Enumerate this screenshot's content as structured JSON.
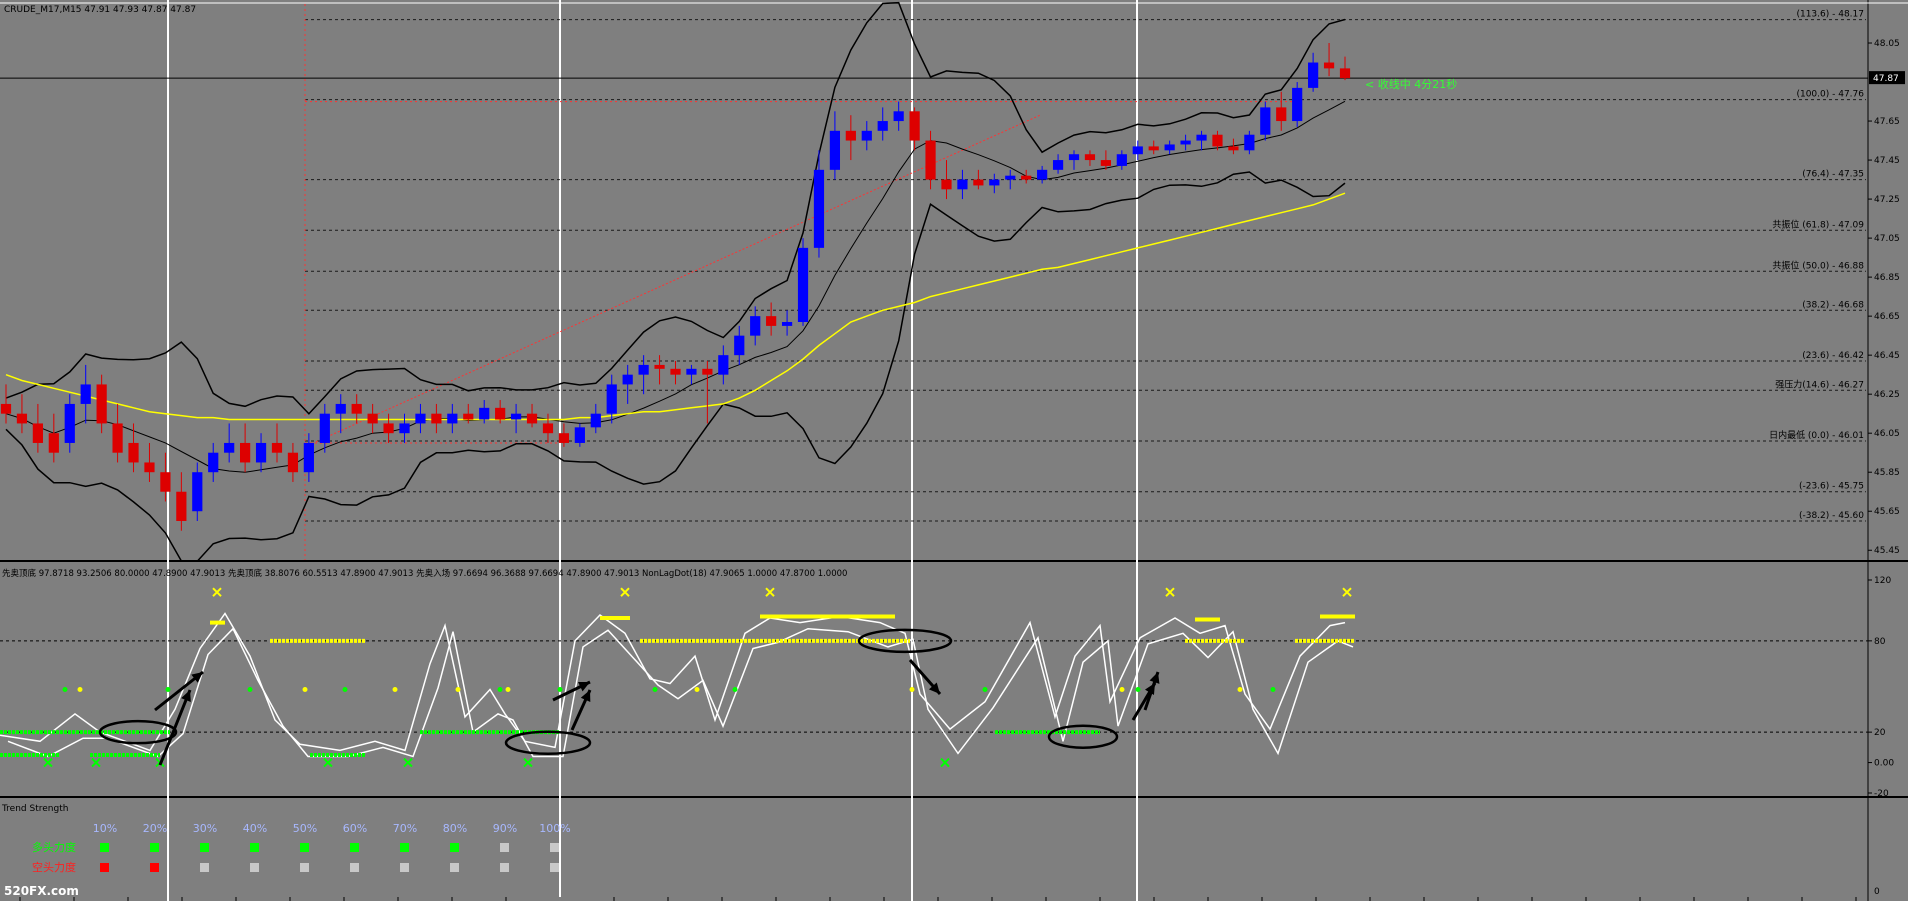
{
  "header": {
    "symbol": "CRUDE_M17,M15",
    "ohlc": "47.91 47.93 47.87 47.87"
  },
  "countdown": "< 收线中 4分21秒",
  "price_tag": "47.87",
  "colors": {
    "bg": "#7f7f7f",
    "bull": "#0000ff",
    "bear": "#dd0000",
    "bands": "#000000",
    "ma": "#ffff00",
    "green": "#00ff00",
    "yellow": "#ffff00",
    "white": "#ffffff"
  },
  "fib_labels": [
    {
      "label": "(113.6) - 48.17",
      "price": 48.17
    },
    {
      "label": "(100.0) - 47.76",
      "price": 47.76
    },
    {
      "label": "(76.4) - 47.35",
      "price": 47.35
    },
    {
      "label": "共振位 (61.8) - 47.09",
      "price": 47.09
    },
    {
      "label": "共振位 (50.0) - 46.88",
      "price": 46.88
    },
    {
      "label": "(38.2) - 46.68",
      "price": 46.68
    },
    {
      "label": "(23.6) - 46.42",
      "price": 46.42
    },
    {
      "label": "强压力(14.6) - 46.27",
      "price": 46.27
    },
    {
      "label": "日内最低 (0.0) - 46.01",
      "price": 46.01
    },
    {
      "label": "(-23.6) - 45.75",
      "price": 45.75
    },
    {
      "label": "(-38.2) - 45.60",
      "price": 45.6
    }
  ],
  "price_axis_ticks": [
    "48.05",
    "47.65",
    "47.45",
    "47.25",
    "47.05",
    "46.85",
    "46.65",
    "46.45",
    "46.25",
    "46.05",
    "45.85",
    "45.65",
    "45.45"
  ],
  "osc_header": "先奥顶底 97.8718 93.2506 80.0000 47.8900 47.9013   先奥顶底 38.8076 60.5513 47.8900 47.9013   先奥入场 97.6694 96.3688 97.6694 47.8900 47.9013   NonLagDot(18) 47.9065 1.0000 47.8700 1.0000",
  "osc_axis_ticks": [
    "120",
    "80",
    "20",
    "0.00",
    "-20"
  ],
  "trend": {
    "title": "Trend Strength",
    "percent_labels": [
      "10%",
      "20%",
      "30%",
      "40%",
      "50%",
      "60%",
      "70%",
      "80%",
      "90%",
      "100%"
    ],
    "bull_label": "多头力度",
    "bear_label": "空头力度",
    "bull_cells": [
      "#00ff00",
      "#00ff00",
      "#00ff00",
      "#00ff00",
      "#00ff00",
      "#00ff00",
      "#00ff00",
      "#00ff00",
      "#c8c8c8",
      "#c8c8c8"
    ],
    "bear_cells": [
      "#ff0000",
      "#ff0000",
      "#c8c8c8",
      "#c8c8c8",
      "#c8c8c8",
      "#c8c8c8",
      "#c8c8c8",
      "#c8c8c8",
      "#c8c8c8",
      "#c8c8c8"
    ],
    "axis_ticks": [
      "0"
    ]
  },
  "watermark": "520FX.com",
  "chart_data": {
    "type": "candlestick",
    "y_range": [
      45.4,
      48.25
    ],
    "ohlc": [
      [
        46.2,
        46.3,
        46.1,
        46.15
      ],
      [
        46.15,
        46.25,
        46.05,
        46.1
      ],
      [
        46.1,
        46.2,
        45.95,
        46.0
      ],
      [
        46.05,
        46.15,
        45.9,
        45.95
      ],
      [
        46.0,
        46.25,
        45.95,
        46.2
      ],
      [
        46.2,
        46.4,
        46.1,
        46.3
      ],
      [
        46.3,
        46.35,
        46.05,
        46.1
      ],
      [
        46.1,
        46.2,
        45.9,
        45.95
      ],
      [
        46.0,
        46.1,
        45.85,
        45.9
      ],
      [
        45.9,
        46.0,
        45.8,
        45.85
      ],
      [
        45.85,
        45.95,
        45.7,
        45.75
      ],
      [
        45.75,
        45.85,
        45.55,
        45.6
      ],
      [
        45.65,
        45.9,
        45.6,
        45.85
      ],
      [
        45.85,
        46.0,
        45.8,
        45.95
      ],
      [
        45.95,
        46.1,
        45.9,
        46.0
      ],
      [
        46.0,
        46.1,
        45.85,
        45.9
      ],
      [
        45.9,
        46.05,
        45.85,
        46.0
      ],
      [
        46.0,
        46.1,
        45.9,
        45.95
      ],
      [
        45.95,
        46.0,
        45.8,
        45.85
      ],
      [
        45.85,
        46.05,
        45.8,
        46.0
      ],
      [
        46.0,
        46.2,
        45.95,
        46.15
      ],
      [
        46.15,
        46.25,
        46.05,
        46.2
      ],
      [
        46.2,
        46.25,
        46.1,
        46.15
      ],
      [
        46.15,
        46.2,
        46.05,
        46.1
      ],
      [
        46.1,
        46.15,
        46.0,
        46.05
      ],
      [
        46.05,
        46.15,
        46.0,
        46.1
      ],
      [
        46.1,
        46.2,
        46.05,
        46.15
      ],
      [
        46.15,
        46.2,
        46.05,
        46.1
      ],
      [
        46.1,
        46.2,
        46.05,
        46.15
      ],
      [
        46.15,
        46.2,
        46.1,
        46.12
      ],
      [
        46.12,
        46.22,
        46.1,
        46.18
      ],
      [
        46.18,
        46.22,
        46.1,
        46.12
      ],
      [
        46.12,
        46.2,
        46.05,
        46.15
      ],
      [
        46.15,
        46.2,
        46.08,
        46.1
      ],
      [
        46.1,
        46.15,
        46.0,
        46.05
      ],
      [
        46.05,
        46.1,
        45.98,
        46.0
      ],
      [
        46.0,
        46.1,
        45.98,
        46.08
      ],
      [
        46.08,
        46.2,
        46.05,
        46.15
      ],
      [
        46.15,
        46.35,
        46.1,
        46.3
      ],
      [
        46.3,
        46.4,
        46.2,
        46.35
      ],
      [
        46.35,
        46.45,
        46.25,
        46.4
      ],
      [
        46.4,
        46.45,
        46.3,
        46.38
      ],
      [
        46.38,
        46.42,
        46.3,
        46.35
      ],
      [
        46.35,
        46.4,
        46.3,
        46.38
      ],
      [
        46.38,
        46.42,
        46.1,
        46.35
      ],
      [
        46.35,
        46.5,
        46.3,
        46.45
      ],
      [
        46.45,
        46.6,
        46.4,
        46.55
      ],
      [
        46.55,
        46.7,
        46.5,
        46.65
      ],
      [
        46.65,
        46.72,
        46.55,
        46.6
      ],
      [
        46.6,
        46.68,
        46.55,
        46.62
      ],
      [
        46.62,
        47.05,
        46.6,
        47.0
      ],
      [
        47.0,
        47.5,
        46.95,
        47.4
      ],
      [
        47.4,
        47.7,
        47.35,
        47.6
      ],
      [
        47.6,
        47.68,
        47.45,
        47.55
      ],
      [
        47.55,
        47.65,
        47.5,
        47.6
      ],
      [
        47.6,
        47.72,
        47.55,
        47.65
      ],
      [
        47.65,
        47.75,
        47.6,
        47.7
      ],
      [
        47.7,
        47.72,
        47.5,
        47.55
      ],
      [
        47.55,
        47.6,
        47.3,
        47.35
      ],
      [
        47.35,
        47.45,
        47.25,
        47.3
      ],
      [
        47.3,
        47.4,
        47.25,
        47.35
      ],
      [
        47.35,
        47.4,
        47.3,
        47.32
      ],
      [
        47.32,
        47.38,
        47.28,
        47.35
      ],
      [
        47.35,
        47.4,
        47.3,
        47.37
      ],
      [
        47.37,
        47.4,
        47.33,
        47.35
      ],
      [
        47.35,
        47.42,
        47.33,
        47.4
      ],
      [
        47.4,
        47.48,
        47.38,
        47.45
      ],
      [
        47.45,
        47.5,
        47.4,
        47.48
      ],
      [
        47.48,
        47.5,
        47.42,
        47.45
      ],
      [
        47.45,
        47.5,
        47.4,
        47.42
      ],
      [
        47.42,
        47.5,
        47.4,
        47.48
      ],
      [
        47.48,
        47.55,
        47.45,
        47.52
      ],
      [
        47.52,
        47.55,
        47.48,
        47.5
      ],
      [
        47.5,
        47.55,
        47.48,
        47.53
      ],
      [
        47.53,
        47.58,
        47.5,
        47.55
      ],
      [
        47.55,
        47.6,
        47.5,
        47.58
      ],
      [
        47.58,
        47.6,
        47.5,
        47.52
      ],
      [
        47.52,
        47.56,
        47.48,
        47.5
      ],
      [
        47.5,
        47.6,
        47.48,
        47.58
      ],
      [
        47.58,
        47.75,
        47.55,
        47.72
      ],
      [
        47.72,
        47.8,
        47.6,
        47.65
      ],
      [
        47.65,
        47.85,
        47.62,
        47.82
      ],
      [
        47.82,
        48.0,
        47.8,
        47.95
      ],
      [
        47.95,
        48.05,
        47.88,
        47.92
      ],
      [
        47.92,
        47.98,
        47.86,
        47.87
      ]
    ],
    "series": [
      {
        "name": "",
        "values": [
          46.35,
          46.32,
          46.3,
          46.28,
          46.26,
          46.24,
          46.22,
          46.2,
          46.18,
          46.16,
          46.15,
          46.14,
          46.13,
          46.13,
          46.12,
          46.12,
          46.12,
          46.12,
          46.12,
          46.12,
          46.12,
          46.12,
          46.12,
          46.12,
          46.12,
          46.12,
          46.12,
          46.12,
          46.12,
          46.12,
          46.12,
          46.12,
          46.12,
          46.12,
          46.12,
          46.12,
          46.13,
          46.13,
          46.14,
          46.15,
          46.16,
          46.16,
          46.17,
          46.18,
          46.19,
          46.2,
          46.23,
          46.27,
          46.32,
          46.37,
          46.43,
          46.5,
          46.56,
          46.62,
          46.65,
          46.68,
          46.7,
          46.72,
          46.75,
          46.77,
          46.79,
          46.81,
          46.83,
          46.85,
          46.87,
          46.89,
          46.9,
          46.92,
          46.94,
          46.96,
          46.98,
          47.0,
          47.02,
          47.04,
          47.06,
          47.08,
          47.1,
          47.12,
          47.14,
          47.16,
          47.18,
          47.2,
          47.22,
          47.25,
          47.28
        ]
      }
    ]
  }
}
